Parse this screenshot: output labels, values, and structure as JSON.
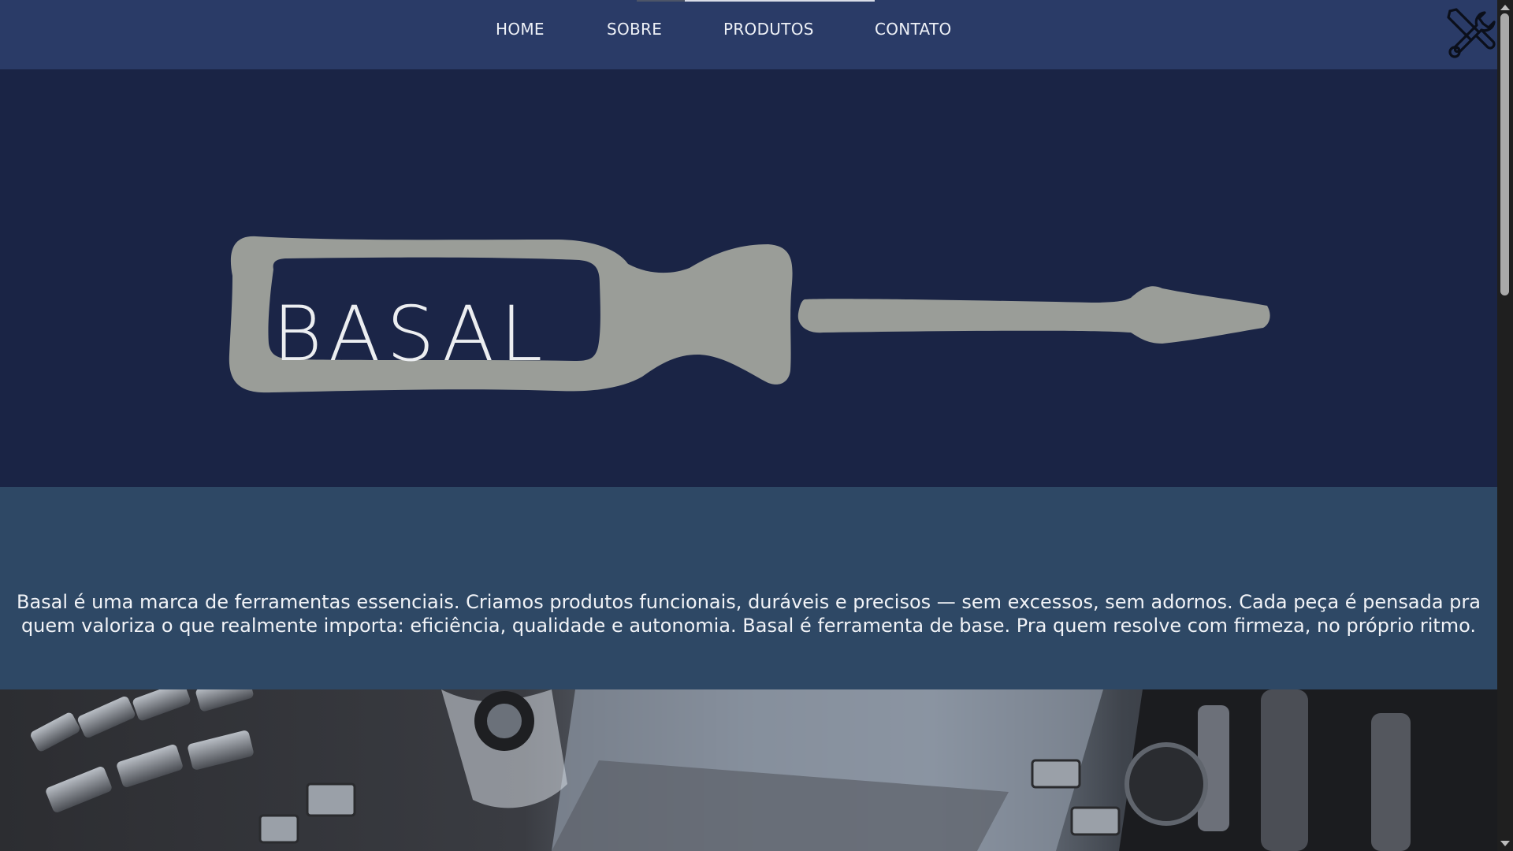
{
  "nav": {
    "items": [
      {
        "label": "HOME"
      },
      {
        "label": "SOBRE"
      },
      {
        "label": "PRODUTOS"
      },
      {
        "label": "CONTATO"
      }
    ],
    "menu_icon": "tools-icon"
  },
  "hero": {
    "logo_text": "BASAL",
    "logo_icon": "screwdriver-logo"
  },
  "about": {
    "text": "Basal é uma marca de ferramentas essenciais. Criamos produtos funcionais, duráveis e precisos — sem excessos, sem adornos. Cada peça é pensada pra quem valoriza o que realmente importa: eficiência, qualidade e autonomia. Basal é ferramenta de base. Pra quem resolve com firmeza, no próprio ritmo."
  },
  "colors": {
    "nav_bg": "#2a3b67",
    "hero_bg": "#1a2445",
    "about_bg": "#2e4865",
    "logo_fill": "#9a9d98"
  }
}
